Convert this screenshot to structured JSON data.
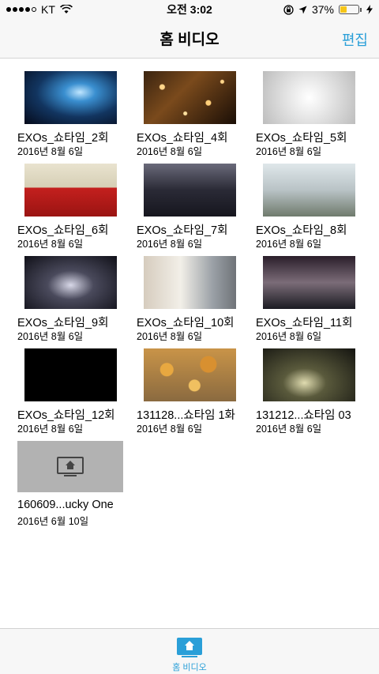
{
  "status_bar": {
    "carrier": "KT",
    "time": "오전 3:02",
    "battery": "37%",
    "battery_level": 0.37,
    "battery_color": "#f5c518"
  },
  "nav": {
    "title": "홈 비디오",
    "edit_label": "편집",
    "accent_color": "#2a9fd8"
  },
  "videos": [
    {
      "title": "EXOs_쇼타임_2회",
      "date": "2016년 8월 6일"
    },
    {
      "title": "EXOs_쇼타임_4회",
      "date": "2016년 8월 6일"
    },
    {
      "title": "EXOs_쇼타임_5회",
      "date": "2016년 8월 6일"
    },
    {
      "title": "EXOs_쇼타임_6회",
      "date": "2016년 8월 6일"
    },
    {
      "title": "EXOs_쇼타임_7회",
      "date": "2016년 8월 6일"
    },
    {
      "title": "EXOs_쇼타임_8회",
      "date": "2016년 8월 6일"
    },
    {
      "title": "EXOs_쇼타임_9회",
      "date": "2016년 8월 6일"
    },
    {
      "title": "EXOs_쇼타임_10회",
      "date": "2016년 8월 6일"
    },
    {
      "title": "EXOs_쇼타임_11회",
      "date": "2016년 8월 6일"
    },
    {
      "title": "EXOs_쇼타임_12회",
      "date": "2016년 8월 6일"
    },
    {
      "title": "131128...쇼타임 1화",
      "date": "2016년 8월 6일"
    },
    {
      "title": "131212...쇼타임 03",
      "date": "2016년 8월 6일"
    },
    {
      "title": "160609...ucky One",
      "date": "2016년 6월 10일"
    }
  ],
  "tab_bar": {
    "home_video_label": "홈 비디오",
    "icon": "home-tv-icon"
  }
}
